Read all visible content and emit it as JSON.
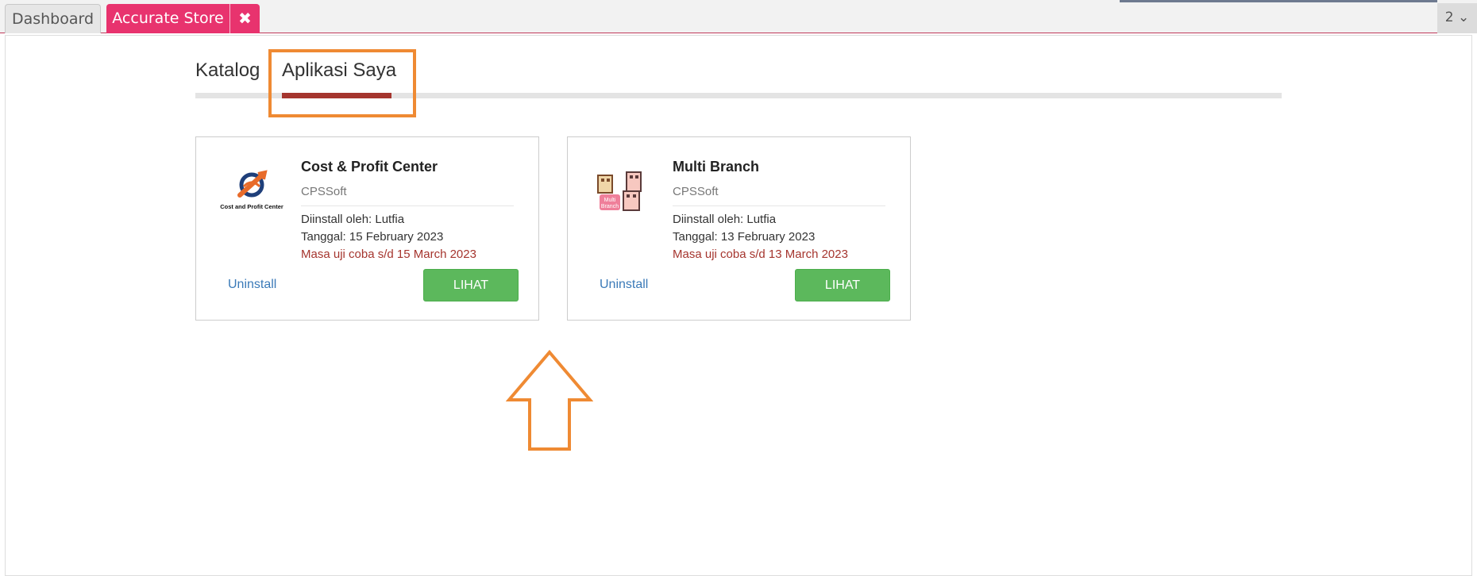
{
  "tabs": {
    "dashboard_label": "Dashboard",
    "store_label": "Accurate Store",
    "close_glyph": "✖",
    "counter": "2 ⌄"
  },
  "subnav": {
    "katalog": "Katalog",
    "aplikasi_saya": "Aplikasi Saya"
  },
  "apps": [
    {
      "title": "Cost & Profit Center",
      "vendor": "CPSSoft",
      "installed_by": "Diinstall oleh: Lutfia",
      "date": "Tanggal: 15 February 2023",
      "trial": "Masa uji coba s/d 15 March 2023",
      "uninstall": "Uninstall",
      "view": "LIHAT",
      "logo_text": "Cost and Profit Center"
    },
    {
      "title": "Multi Branch",
      "vendor": "CPSSoft",
      "installed_by": "Diinstall oleh: Lutfia",
      "date": "Tanggal: 13 February 2023",
      "trial": "Masa uji coba s/d 13 March 2023",
      "uninstall": "Uninstall",
      "view": "LIHAT",
      "logo_text_1": "Multi",
      "logo_text_2": "Branch"
    }
  ],
  "colors": {
    "tab_active": "#e8336e",
    "accent_underline": "#a5352e",
    "highlight": "#ef8a33",
    "button_green": "#5cb85c",
    "link_blue": "#3b7ab8"
  }
}
